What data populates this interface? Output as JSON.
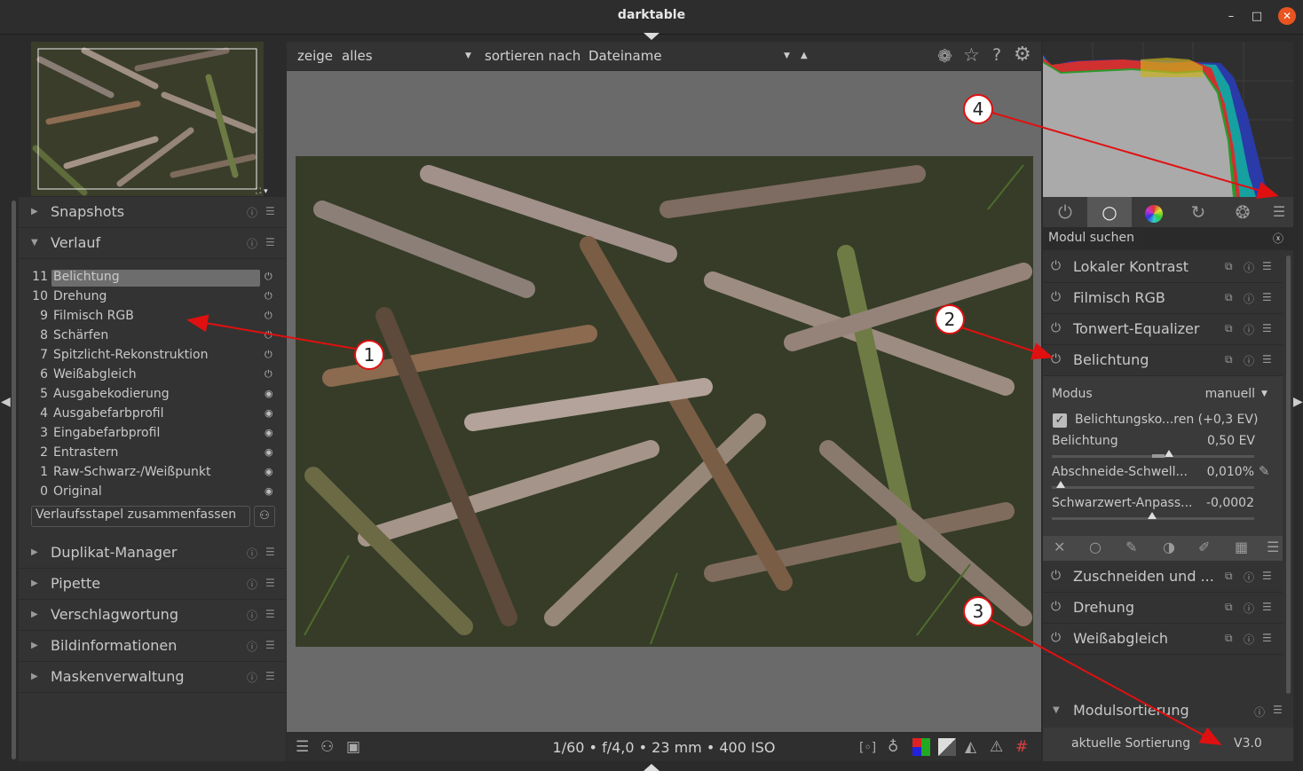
{
  "window": {
    "title": "darktable",
    "minimize": "–",
    "maximize": "□",
    "close": "✕"
  },
  "topbar": {
    "show_label": "zeige",
    "show_value": "alles",
    "sort_label": "sortieren nach",
    "sort_value": "Dateiname",
    "icons": [
      "color-labels-icon",
      "star-icon",
      "help-icon",
      "gear-icon"
    ]
  },
  "left": {
    "sections_top": [
      {
        "label": "Snapshots"
      }
    ],
    "verlauf": {
      "label": "Verlauf",
      "items": [
        {
          "num": "11",
          "name": "Belichtung",
          "state": "⏻"
        },
        {
          "num": "10",
          "name": "Drehung",
          "state": "⏻"
        },
        {
          "num": "9",
          "name": "Filmisch RGB",
          "state": "⏻"
        },
        {
          "num": "8",
          "name": "Schärfen",
          "state": "⏻"
        },
        {
          "num": "7",
          "name": "Spitzlicht-Rekonstruktion",
          "state": "⏻"
        },
        {
          "num": "6",
          "name": "Weißabgleich",
          "state": "⏻"
        },
        {
          "num": "5",
          "name": "Ausgabekodierung",
          "state": "◉"
        },
        {
          "num": "4",
          "name": "Ausgabefarbprofil",
          "state": "◉"
        },
        {
          "num": "3",
          "name": "Eingabefarbprofil",
          "state": "◉"
        },
        {
          "num": "2",
          "name": "Entrastern",
          "state": "◉"
        },
        {
          "num": "1",
          "name": "Raw-Schwarz-/Weißpunkt",
          "state": "◉"
        },
        {
          "num": "0",
          "name": "Original",
          "state": "◉"
        }
      ],
      "compress_label": "Verlaufsstapel zusammenfassen"
    },
    "sections_bottom": [
      {
        "label": "Duplikat-Manager"
      },
      {
        "label": "Pipette"
      },
      {
        "label": "Verschlagwortung"
      },
      {
        "label": "Bildinformationen"
      },
      {
        "label": "Maskenverwaltung"
      }
    ]
  },
  "bottombar": {
    "exif": "1/60 • f/4,0 • 23 mm • 400 ISO"
  },
  "right": {
    "search_label": "Modul suchen",
    "search_value": "",
    "modules_top": [
      {
        "label": "Lokaler Kontrast"
      },
      {
        "label": "Filmisch RGB"
      },
      {
        "label": "Tonwert-Equalizer"
      },
      {
        "label": "Belichtung"
      }
    ],
    "exposure": {
      "mode_label": "Modus",
      "mode_value": "manuell",
      "compensation_label": "Belichtungsko...ren (+0,3 EV)",
      "exposure_label": "Belichtung",
      "exposure_value": "0,50 EV",
      "clip_label": "Abschneide-Schwell...",
      "clip_value": "0,010%",
      "black_label": "Schwarzwert-Anpass...",
      "black_value": "-0,0002"
    },
    "modules_bottom": [
      {
        "label": "Zuschneiden und ..."
      },
      {
        "label": "Drehung"
      },
      {
        "label": "Weißabgleich"
      }
    ],
    "sort": {
      "label": "Modulsortierung",
      "current_label": "aktuelle Sortierung",
      "current_value": "V3.0"
    }
  },
  "annotations": [
    "1",
    "2",
    "3",
    "4"
  ],
  "colors": {
    "accent_close": "#e95420",
    "annotation": "#e01010"
  }
}
